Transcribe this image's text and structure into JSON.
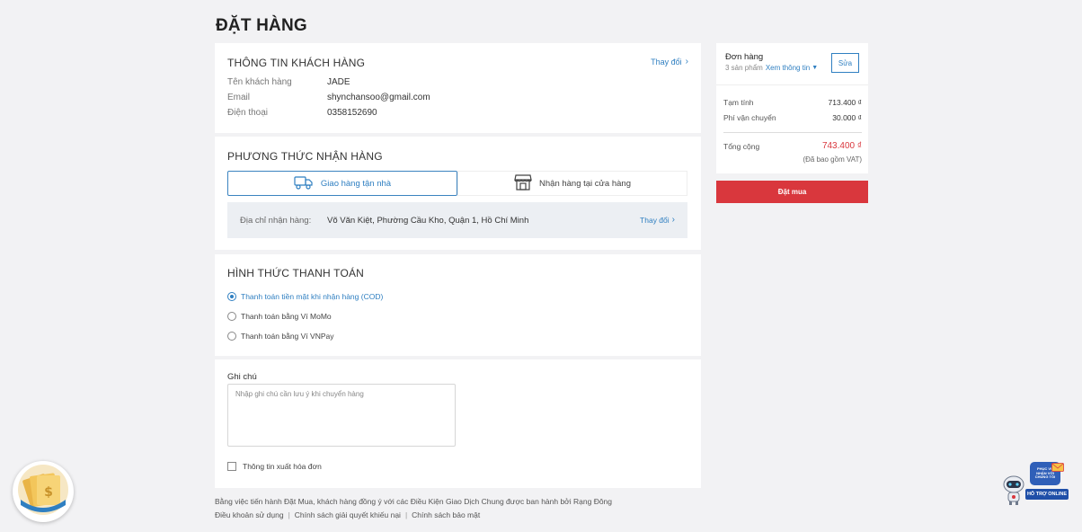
{
  "page": {
    "title": "ĐẶT HÀNG"
  },
  "customer": {
    "title": "THÔNG TIN KHÁCH HÀNG",
    "change_label": "Thay đổi",
    "rows": [
      {
        "label": "Tên khách hàng",
        "value": "JADE"
      },
      {
        "label": "Email",
        "value": "shynchansoo@gmail.com"
      },
      {
        "label": "Điện thoại",
        "value": "0358152690"
      }
    ]
  },
  "delivery": {
    "title": "PHƯƠNG THỨC NHẬN HÀNG",
    "options": [
      {
        "label": "Giao hàng tận nhà",
        "icon": "truck-icon",
        "active": true
      },
      {
        "label": "Nhận hàng tại cửa hàng",
        "icon": "store-icon",
        "active": false
      }
    ],
    "address_label": "Địa chỉ nhận hàng:",
    "address_value": "Võ Văn Kiệt, Phường Cầu Kho, Quận 1, Hồ Chí Minh",
    "change_label": "Thay đổi"
  },
  "payment": {
    "title": "HÌNH THỨC THANH TOÁN",
    "options": [
      {
        "label": "Thanh toán tiền mặt khi nhận hàng (COD)",
        "selected": true
      },
      {
        "label": "Thanh toán bằng Ví MoMo",
        "selected": false
      },
      {
        "label": "Thanh toán bằng Ví VNPay",
        "selected": false
      }
    ]
  },
  "note": {
    "title": "Ghi chú",
    "placeholder": "Nhập ghi chú cần lưu ý khi chuyển hàng",
    "invoice_label": "Thông tin xuất hóa đơn"
  },
  "summary": {
    "title": "Đơn hàng",
    "product_count": "3 sản phẩm",
    "view_info": "Xem thông tin",
    "edit_label": "Sửa",
    "subtotal_label": "Tạm tính",
    "subtotal_value": "713.400 ₫",
    "shipping_label": "Phí vận chuyển",
    "shipping_value": "30.000 ₫",
    "total_label": "Tổng cộng",
    "total_value": "743.400 ₫",
    "vat_note": "(Đã bao gồm VAT)",
    "order_button": "Đặt mua",
    "total_color": "#d9373d"
  },
  "footer": {
    "agreement": "Bằng việc tiến hành Đặt Mua, khách hàng đồng ý với các Điều Kiện Giao Dịch Chung được ban hành bởi Rạng Đông",
    "links": [
      "Điều khoản sử dụng",
      "Chính sách giải quyết khiếu nại",
      "Chính sách bảo mật"
    ],
    "separator": "|"
  },
  "widgets": {
    "support_label": "HỖ TRỢ ONLINE",
    "bubble_text": "PHỤC VỤ NHẬN VỚI CHÚNG TÔI"
  }
}
